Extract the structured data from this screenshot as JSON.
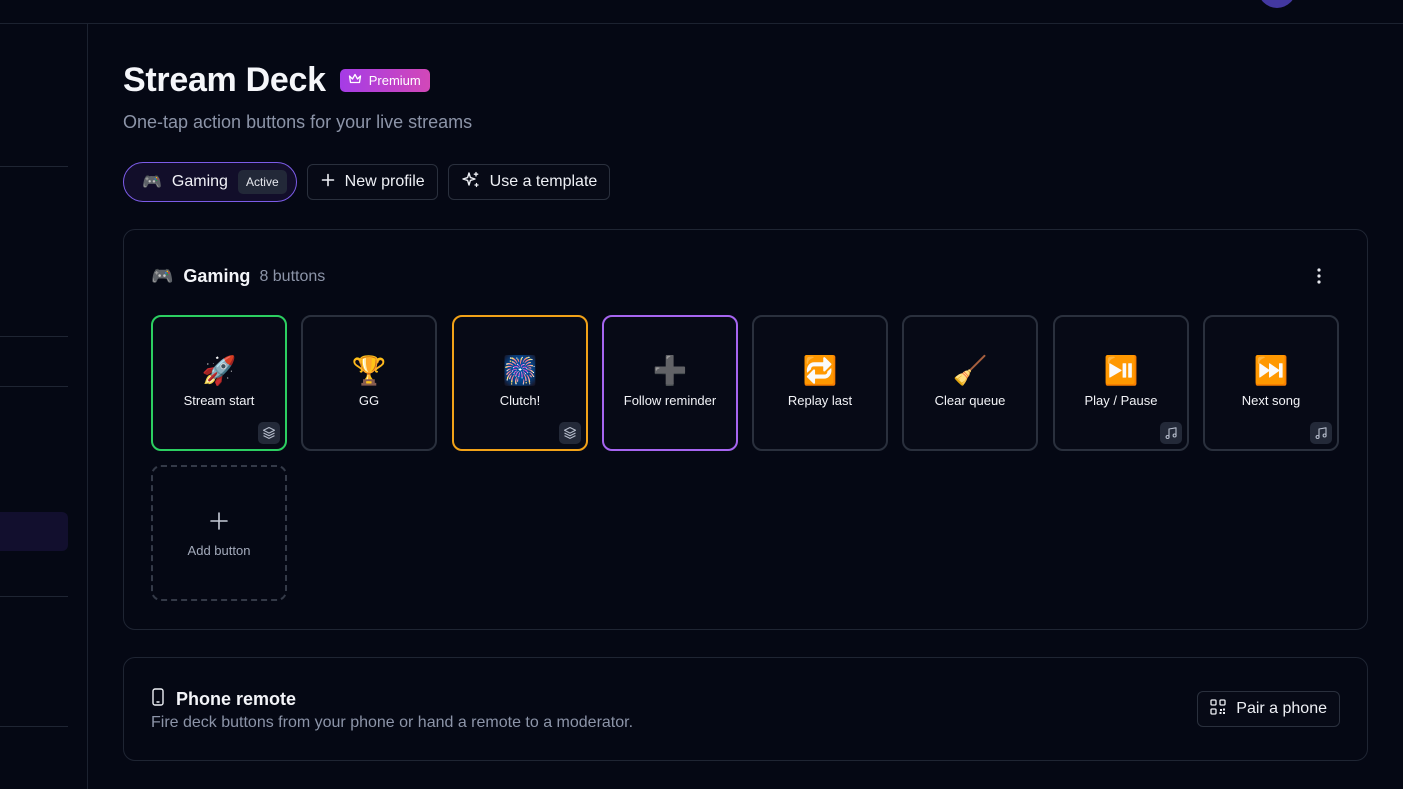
{
  "header": {
    "title": "Stream Deck",
    "badge": "Premium",
    "subtitle": "One-tap action buttons for your live streams"
  },
  "profiles": {
    "active": {
      "icon": "🎮",
      "name": "Gaming",
      "tag": "Active"
    },
    "new_profile": "New profile",
    "use_template": "Use a template"
  },
  "deck": {
    "icon": "🎮",
    "name": "Gaming",
    "count": "8 buttons",
    "buttons": [
      {
        "emoji": "🚀",
        "label": "Stream start",
        "accent": "#2ccf61",
        "corner_icon": "layers-icon"
      },
      {
        "emoji": "🏆",
        "label": "GG",
        "accent": "",
        "corner_icon": ""
      },
      {
        "emoji": "🎆",
        "label": "Clutch!",
        "accent": "#f2a218",
        "corner_icon": "layers-icon"
      },
      {
        "emoji": "➕",
        "label": "Follow reminder",
        "accent": "#a665f0",
        "corner_icon": ""
      },
      {
        "emoji": "🔁",
        "label": "Replay last",
        "accent": "",
        "corner_icon": ""
      },
      {
        "emoji": "🧹",
        "label": "Clear queue",
        "accent": "",
        "corner_icon": ""
      },
      {
        "emoji": "⏯️",
        "label": "Play / Pause",
        "accent": "",
        "corner_icon": "music-note-icon"
      },
      {
        "emoji": "⏭️",
        "label": "Next song",
        "accent": "",
        "corner_icon": "music-note-icon"
      }
    ],
    "add_label": "Add button"
  },
  "remote": {
    "title": "Phone remote",
    "description": "Fire deck buttons from your phone or hand a remote to a moderator.",
    "pair_label": "Pair a phone"
  },
  "colors": {
    "background": "#050814",
    "border": "#1f2533",
    "accent_purple": "#7c5ce8",
    "premium_gradient_start": "#a53ce6",
    "premium_gradient_end": "#d248b8"
  }
}
